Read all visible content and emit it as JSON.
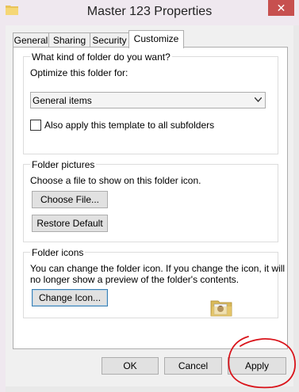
{
  "window": {
    "title": "Master 123 Properties",
    "close_label": "✕"
  },
  "tabs": [
    {
      "label": "General",
      "active": false
    },
    {
      "label": "Sharing",
      "active": false
    },
    {
      "label": "Security",
      "active": false
    },
    {
      "label": "Customize",
      "active": true
    }
  ],
  "folder_type": {
    "group_title": "What kind of folder do you want?",
    "optimize_label": "Optimize this folder for:",
    "dropdown_value": "General items",
    "apply_subfolders_label": "Also apply this template to all subfolders",
    "apply_subfolders_checked": false
  },
  "folder_pictures": {
    "group_title": "Folder pictures",
    "description": "Choose a file to show on this folder icon.",
    "choose_file_label": "Choose File...",
    "restore_default_label": "Restore Default"
  },
  "folder_icons": {
    "group_title": "Folder icons",
    "description_line1": "You can change the folder icon. If you change the icon, it will",
    "description_line2": "no longer show a preview of the folder's contents.",
    "change_icon_label": "Change Icon..."
  },
  "buttons": {
    "ok": "OK",
    "cancel": "Cancel",
    "apply": "Apply"
  },
  "colors": {
    "close_button": "#c7504f",
    "annotation": "#d9141b",
    "default_button_border": "#3c7fb1"
  }
}
